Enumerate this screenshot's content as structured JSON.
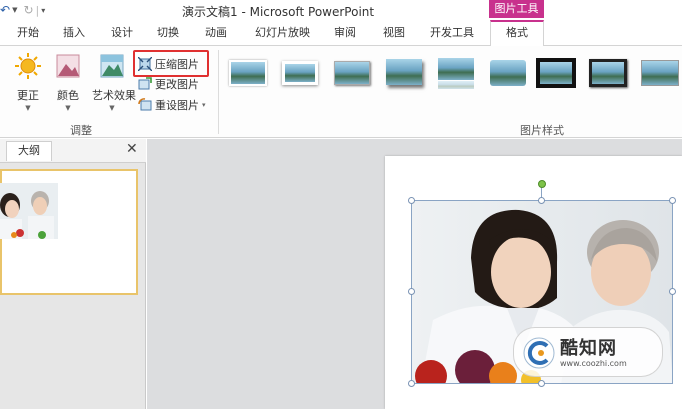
{
  "window": {
    "title": "演示文稿1 - Microsoft PowerPoint",
    "context_header": "图片工具"
  },
  "tabs": [
    "开始",
    "插入",
    "设计",
    "切换",
    "动画",
    "幻灯片放映",
    "审阅",
    "视图",
    "开发工具"
  ],
  "context_tab": "格式",
  "ribbon": {
    "adjust": {
      "correct": "更正",
      "color": "颜色",
      "artistic": "艺术效果",
      "compress": "压缩图片",
      "change": "更改图片",
      "reset": "重设图片",
      "group_label": "调整"
    },
    "styles_group_label": "图片样式"
  },
  "left_pane": {
    "outline_tab": "大纲",
    "close_glyph": "✕"
  },
  "watermark": {
    "brand": "酷知网",
    "url": "www.coozhi.com"
  },
  "colors": {
    "context_accent": "#c8318d",
    "highlight_box": "#e03030",
    "thumbnail_border": "#e9c46a"
  }
}
